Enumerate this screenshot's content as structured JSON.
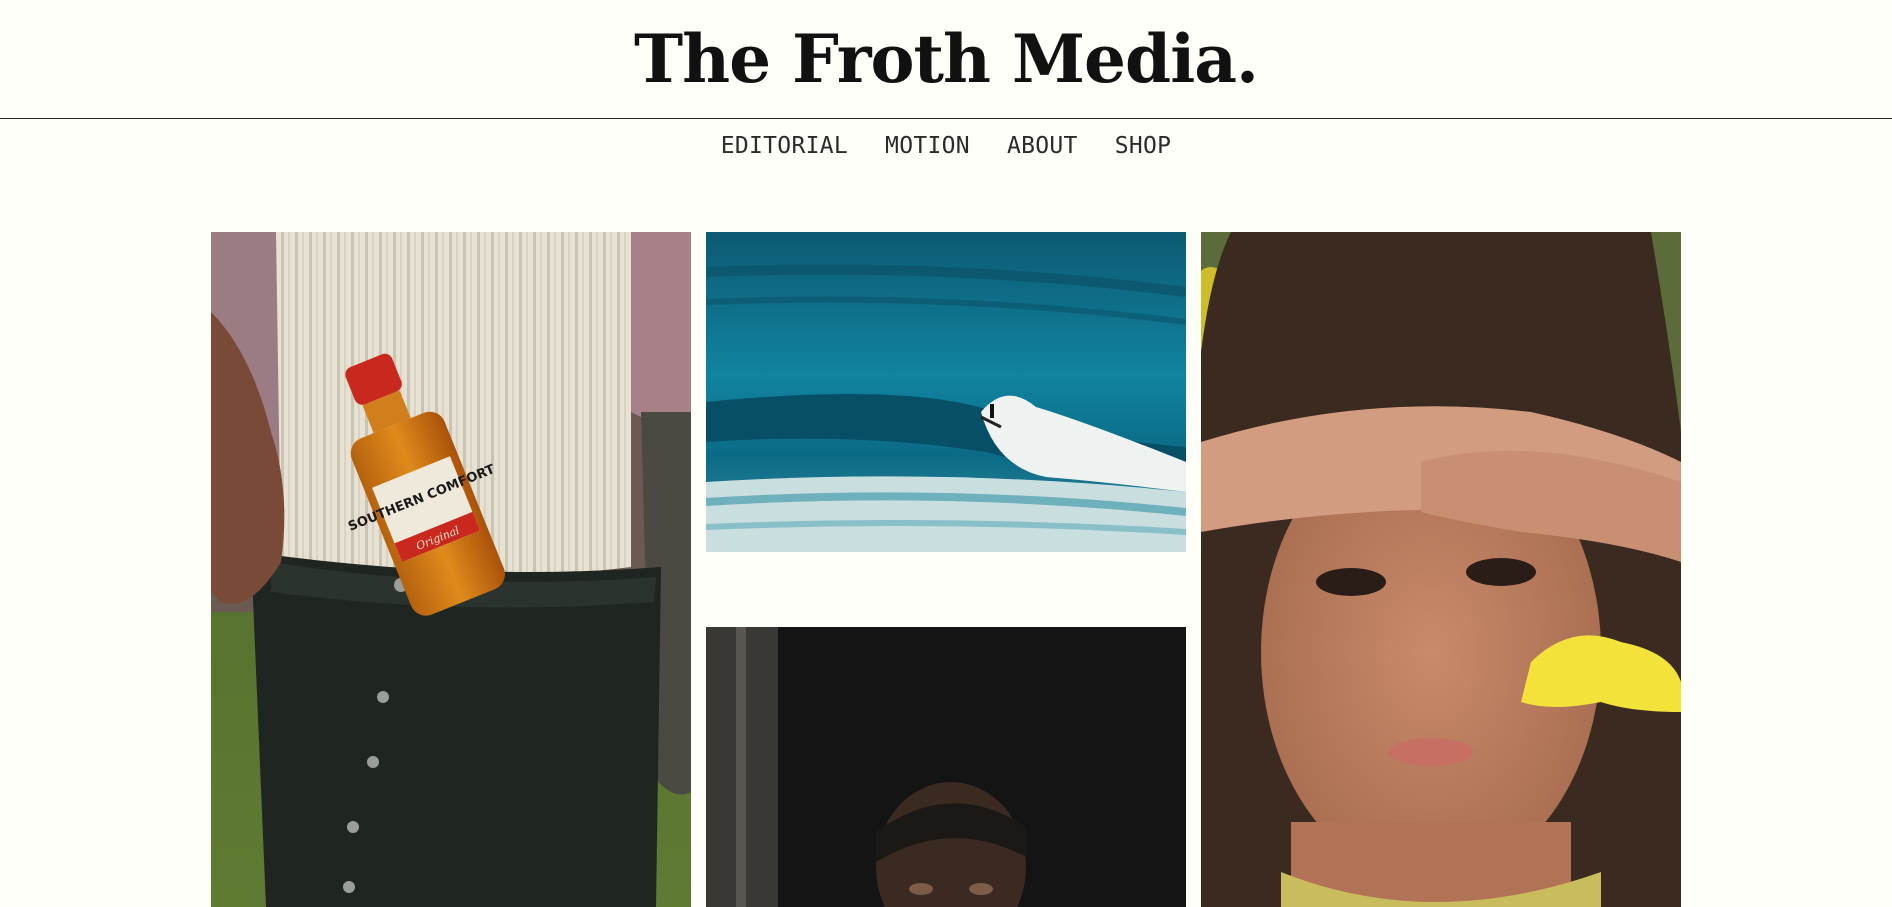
{
  "header": {
    "title": "The Froth Media."
  },
  "nav": {
    "items": [
      {
        "label": "EDITORIAL"
      },
      {
        "label": "MOTION"
      },
      {
        "label": "ABOUT"
      },
      {
        "label": "SHOP"
      }
    ]
  },
  "gallery": {
    "tiles": [
      {
        "subject": "person-with-southern-comfort-bottle-in-pocket",
        "bottle_label": "SOUTHERN COMFORT",
        "bottle_sublabel": "Original"
      },
      {
        "subject": "surfer-riding-wave"
      },
      {
        "subject": "elderly-man-portrait-in-dark-doorway"
      },
      {
        "subject": "woman-shading-eyes-with-yellow-flower"
      }
    ]
  },
  "colors": {
    "background": "#fffffa",
    "text": "#111111",
    "divider": "#2a2a2a"
  }
}
